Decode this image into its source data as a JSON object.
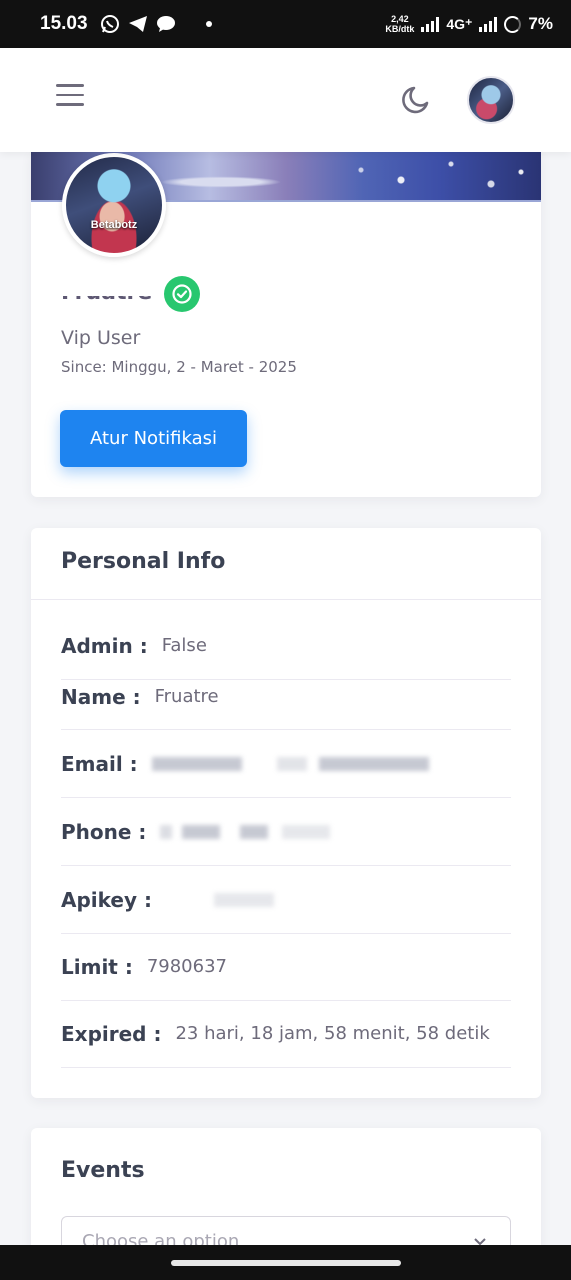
{
  "status_bar": {
    "time": "15.03",
    "net_speed_top": "2,42",
    "net_speed_bottom": "KB/dtk",
    "network": "4G⁺",
    "battery": "7%"
  },
  "header": {
    "menu_icon": "hamburger-menu-icon",
    "theme_icon": "moon-icon"
  },
  "profile": {
    "avatar_text": "Betabotz",
    "name": "Fruatre",
    "role": "Vip User",
    "since": "Since: Minggu, 2 - Maret - 2025",
    "notif_button": "Atur Notifikasi",
    "verified_icon": "check-circle-icon"
  },
  "personal_info": {
    "title": "Personal Info",
    "rows": [
      {
        "label": "Admin :",
        "value": "False"
      },
      {
        "label": "Name :",
        "value": "Fruatre"
      },
      {
        "label": "Email :",
        "value": ""
      },
      {
        "label": "Phone :",
        "value": ""
      },
      {
        "label": "Apikey :",
        "value": ""
      },
      {
        "label": "Limit :",
        "value": "7980637"
      },
      {
        "label": "Expired :",
        "value": "23 hari, 18 jam, 58 menit, 58 detik"
      }
    ]
  },
  "events": {
    "title": "Events",
    "select_placeholder": "Choose an option"
  },
  "colors": {
    "primary": "#1e84f0",
    "success": "#28c76f",
    "background": "#f4f5f8"
  }
}
